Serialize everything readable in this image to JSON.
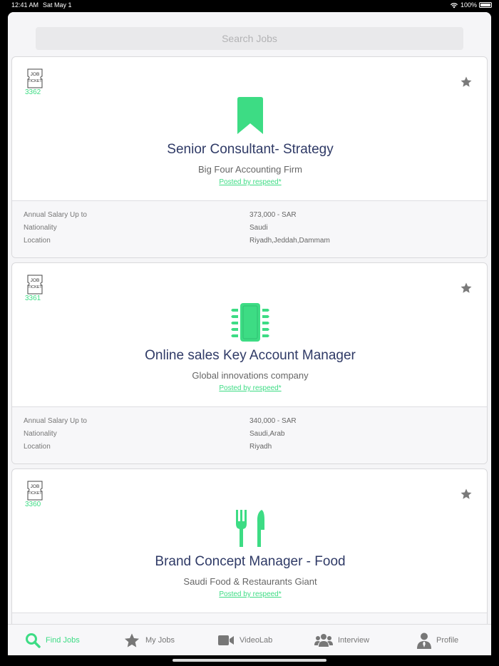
{
  "status_bar": {
    "time": "12:41 AM",
    "date": "Sat May 1",
    "battery": "100%"
  },
  "search": {
    "placeholder": "Search Jobs"
  },
  "ticket_label": [
    "JOB",
    "TICKET"
  ],
  "jobs": [
    {
      "ticket_number": "3362",
      "icon": "bookmark-icon",
      "title": "Senior Consultant- Strategy",
      "company": "Big Four Accounting Firm",
      "posted_by": "Posted by respeed*",
      "details": [
        {
          "label": "Annual Salary Up to",
          "value": "373,000 - SAR"
        },
        {
          "label": "Nationality",
          "value": "Saudi"
        },
        {
          "label": "Location",
          "value": "Riyadh,Jeddah,Dammam"
        }
      ]
    },
    {
      "ticket_number": "3361",
      "icon": "microchip-icon",
      "title": "Online sales Key Account Manager",
      "company": "Global innovations company",
      "posted_by": "Posted by respeed*",
      "details": [
        {
          "label": "Annual Salary Up to",
          "value": "340,000 - SAR"
        },
        {
          "label": "Nationality",
          "value": "Saudi,Arab"
        },
        {
          "label": "Location",
          "value": "Riyadh"
        }
      ]
    },
    {
      "ticket_number": "3360",
      "icon": "fork-knife-icon",
      "title": "Brand Concept Manager - Food",
      "company": "Saudi Food & Restaurants Giant",
      "posted_by": "Posted by respeed*",
      "details": []
    }
  ],
  "tabs": [
    {
      "label": "Find Jobs",
      "icon": "search-icon",
      "active": true
    },
    {
      "label": "My Jobs",
      "icon": "star-icon",
      "active": false
    },
    {
      "label": "VideoLab",
      "icon": "video-camera-icon",
      "active": false
    },
    {
      "label": "Interview",
      "icon": "users-icon",
      "active": false
    },
    {
      "label": "Profile",
      "icon": "user-tie-icon",
      "active": false
    }
  ],
  "colors": {
    "accent": "#3ddc84",
    "title": "#2f3a66",
    "inactive": "#777777"
  }
}
